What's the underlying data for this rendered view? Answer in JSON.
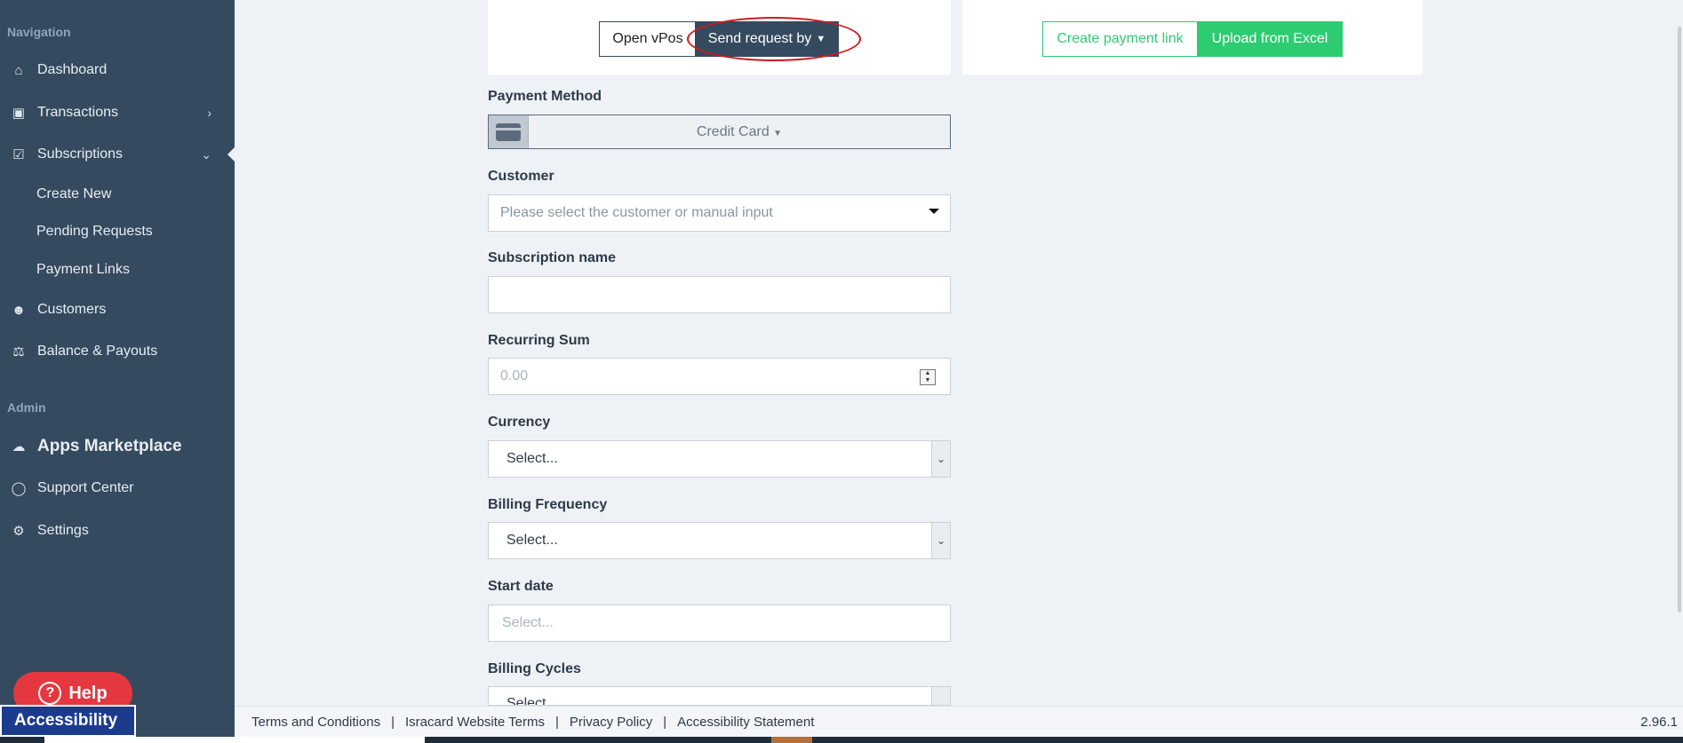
{
  "sidebar": {
    "nav_heading": "Navigation",
    "items": [
      {
        "label": "Dashboard",
        "icon": "home-icon"
      },
      {
        "label": "Transactions",
        "icon": "money-icon"
      },
      {
        "label": "Subscriptions",
        "icon": "calendar-check-icon"
      },
      {
        "label": "Customers",
        "icon": "users-icon"
      },
      {
        "label": "Balance & Payouts",
        "icon": "balance-scale-icon"
      }
    ],
    "sub_items": [
      "Create New",
      "Pending Requests",
      "Payment Links"
    ],
    "admin_heading": "Admin",
    "admin_items": [
      {
        "label": "Apps Marketplace",
        "icon": "cloud-download-icon"
      },
      {
        "label": "Support Center",
        "icon": "lifebuoy-icon"
      },
      {
        "label": "Settings",
        "icon": "gear-icon"
      }
    ]
  },
  "toolbar": {
    "open_vpos": "Open vPos",
    "send_request": "Send request by",
    "create_link": "Create payment link",
    "upload_excel": "Upload from Excel"
  },
  "form": {
    "payment_method": {
      "label": "Payment Method",
      "value": "Credit Card"
    },
    "customer": {
      "label": "Customer",
      "placeholder": "Please select the customer or manual input"
    },
    "subscription_name": {
      "label": "Subscription name",
      "value": ""
    },
    "recurring_sum": {
      "label": "Recurring Sum",
      "placeholder": "0.00"
    },
    "currency": {
      "label": "Currency",
      "value": "Select..."
    },
    "billing_frequency": {
      "label": "Billing Frequency",
      "value": "Select..."
    },
    "start_date": {
      "label": "Start date",
      "placeholder": "Select..."
    },
    "billing_cycles": {
      "label": "Billing Cycles",
      "value": "Select..."
    }
  },
  "help": {
    "label": "Help"
  },
  "accessibility": {
    "label": "Accessibility"
  },
  "footer": {
    "links": [
      "Terms and Conditions",
      "Isracard Website Terms",
      "Privacy Policy",
      "Accessibility Statement"
    ],
    "separator": "|",
    "version": "2.96.1"
  },
  "colors": {
    "sidebar": "#354a5f",
    "accent_green": "#2ecc71",
    "highlight_red": "#d0191e",
    "help_red": "#e4373f"
  }
}
